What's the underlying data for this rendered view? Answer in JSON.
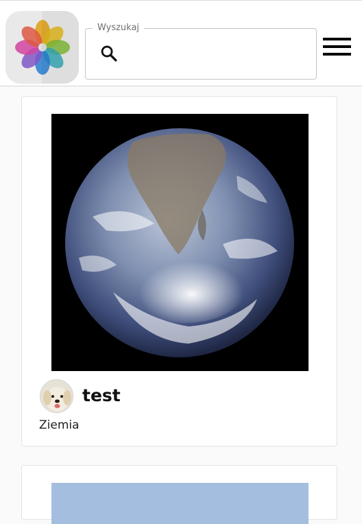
{
  "header": {
    "logo": "photos-flower-logo-icon",
    "search": {
      "label": "Wyszukaj",
      "placeholder": "",
      "value": "",
      "icon": "search-icon"
    },
    "menu_icon": "hamburger-menu-icon"
  },
  "feed": {
    "posts": [
      {
        "image": "earth-photo",
        "author": "test",
        "avatar": "dog-avatar",
        "caption": "Ziemia"
      },
      {
        "image": "sky-photo"
      }
    ]
  },
  "colors": {
    "background": "#fafafa",
    "card": "#ffffff",
    "border": "#e2e2e2",
    "text": "#111111"
  }
}
